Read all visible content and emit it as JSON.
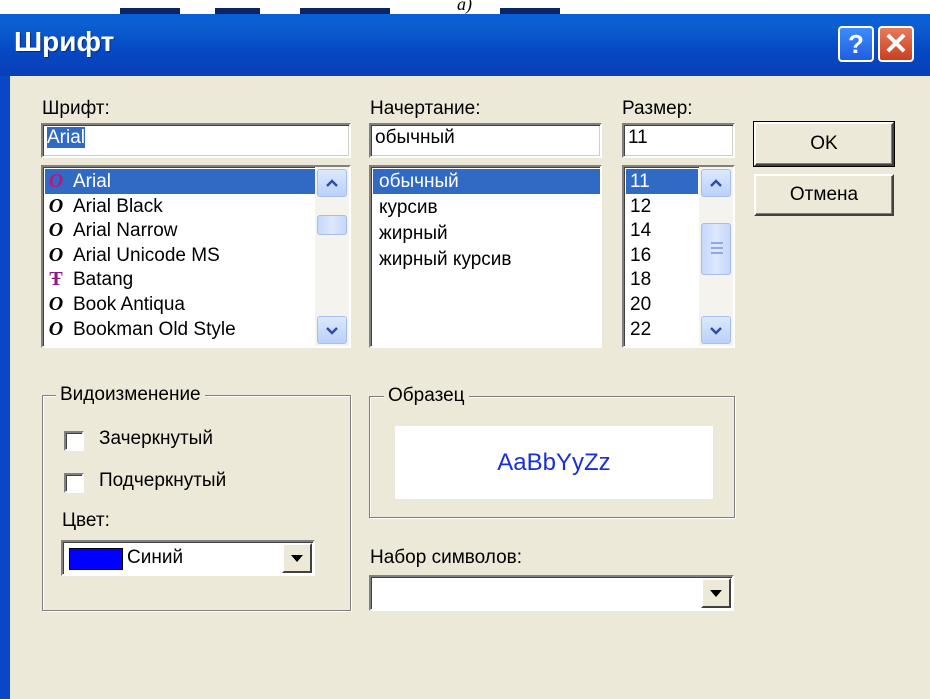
{
  "window": {
    "title": "Шрифт",
    "help_label": "?",
    "close_label": "✕",
    "top_letter": "a)"
  },
  "font": {
    "label": "Шрифт:",
    "value": "Arial",
    "items": [
      {
        "label": "Arial",
        "icon": "opentype-icon",
        "glyph": "O"
      },
      {
        "label": "Arial Black",
        "icon": "opentype-icon",
        "glyph": "O"
      },
      {
        "label": "Arial Narrow",
        "icon": "opentype-icon",
        "glyph": "O"
      },
      {
        "label": "Arial Unicode MS",
        "icon": "opentype-icon",
        "glyph": "O"
      },
      {
        "label": "Batang",
        "icon": "truetype-icon",
        "glyph": "Ŧ"
      },
      {
        "label": "Book Antiqua",
        "icon": "opentype-icon",
        "glyph": "O"
      },
      {
        "label": "Bookman Old Style",
        "icon": "opentype-icon",
        "glyph": "O"
      }
    ],
    "selected_index": 0
  },
  "style": {
    "label": "Начертание:",
    "value": "обычный",
    "items": [
      "обычный",
      "курсив",
      "жирный",
      "жирный курсив"
    ],
    "selected_index": 0
  },
  "size": {
    "label": "Размер:",
    "value": "11",
    "items": [
      "11",
      "12",
      "14",
      "16",
      "18",
      "20",
      "22"
    ],
    "selected_index": 0
  },
  "buttons": {
    "ok": "OK",
    "cancel": "Отмена"
  },
  "effects": {
    "legend": "Видоизменение",
    "strikethrough": "Зачеркнутый",
    "underline": "Подчеркнутый",
    "strikethrough_checked": false,
    "underline_checked": false,
    "color_label": "Цвет:",
    "color_value": "Синий",
    "color_swatch": "#0000ff"
  },
  "sample": {
    "legend": "Образец",
    "text": "AaBbYyZz",
    "color": "#1a2fd8"
  },
  "charset": {
    "label": "Набор символов:",
    "value": ""
  },
  "colors": {
    "titlebar": "#0548c4",
    "selection": "#316ac5",
    "dialog_bg": "#ece9d8"
  }
}
